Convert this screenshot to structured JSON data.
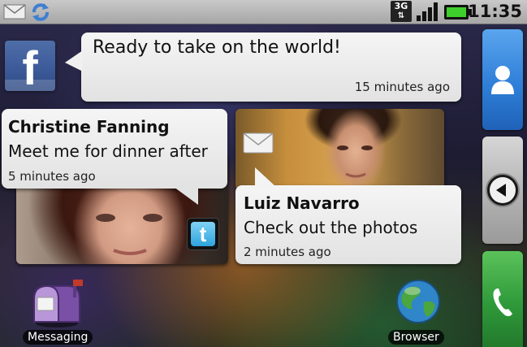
{
  "status_bar": {
    "network": "3G",
    "time": "11:35"
  },
  "facebook_update": {
    "message": "Ready to take on the world!",
    "time_ago": "15 minutes ago"
  },
  "twitter_update": {
    "sender": "Christine Fanning",
    "message": "Meet me for dinner after",
    "time_ago": "5 minutes ago"
  },
  "message_update": {
    "sender": "Luiz Navarro",
    "message": "Check out the photos",
    "time_ago": "2 minutes ago"
  },
  "apps": {
    "messaging_label": "Messaging",
    "browser_label": "Browser"
  },
  "colors": {
    "facebook": "#3b5998",
    "contacts_dock": "#2f7fd8",
    "phone_dock": "#2f9a3a"
  }
}
